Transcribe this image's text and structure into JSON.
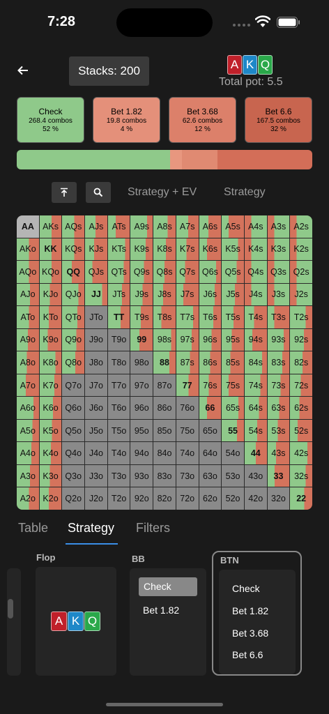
{
  "status": {
    "time": "7:28"
  },
  "header": {
    "stacks": "Stacks: 200",
    "board": [
      {
        "rank": "A",
        "color": "#c0202a"
      },
      {
        "rank": "K",
        "color": "#1e88c8"
      },
      {
        "rank": "Q",
        "color": "#2aa84a"
      }
    ],
    "total_pot": "Total pot: 5.5"
  },
  "actions": [
    {
      "label": "Check",
      "combos": "268.4 combos",
      "pct": "52 %",
      "color": "#8fc98a"
    },
    {
      "label": "Bet 1.82",
      "combos": "19.8 combos",
      "pct": "4 %",
      "color": "#e4907a"
    },
    {
      "label": "Bet 3.68",
      "combos": "62.6 combos",
      "pct": "12 %",
      "color": "#dc806a"
    },
    {
      "label": "Bet 6.6",
      "combos": "167.5 combos",
      "pct": "32 %",
      "color": "#c8654f"
    }
  ],
  "frequencies": [
    0.52,
    0.04,
    0.12,
    0.32
  ],
  "toolbar": {
    "strategy_ev": "Strategy + EV",
    "strategy": "Strategy"
  },
  "grid": {
    "ranks": [
      "A",
      "K",
      "Q",
      "J",
      "T",
      "9",
      "8",
      "7",
      "6",
      "5",
      "4",
      "3",
      "2"
    ]
  },
  "tabs": [
    "Table",
    "Strategy",
    "Filters"
  ],
  "tree": {
    "flop_title": "Flop",
    "bb_title": "BB",
    "btn_title": "BTN",
    "bb_options": [
      "Check",
      "Bet 1.82"
    ],
    "btn_options": [
      "Check",
      "Bet 1.82",
      "Bet 3.68",
      "Bet 6.6"
    ]
  },
  "colors": {
    "check": "#8fc98a",
    "bet": "#d4735c",
    "empty": "#8a8a8a",
    "blocked": "#b5b5b5"
  }
}
